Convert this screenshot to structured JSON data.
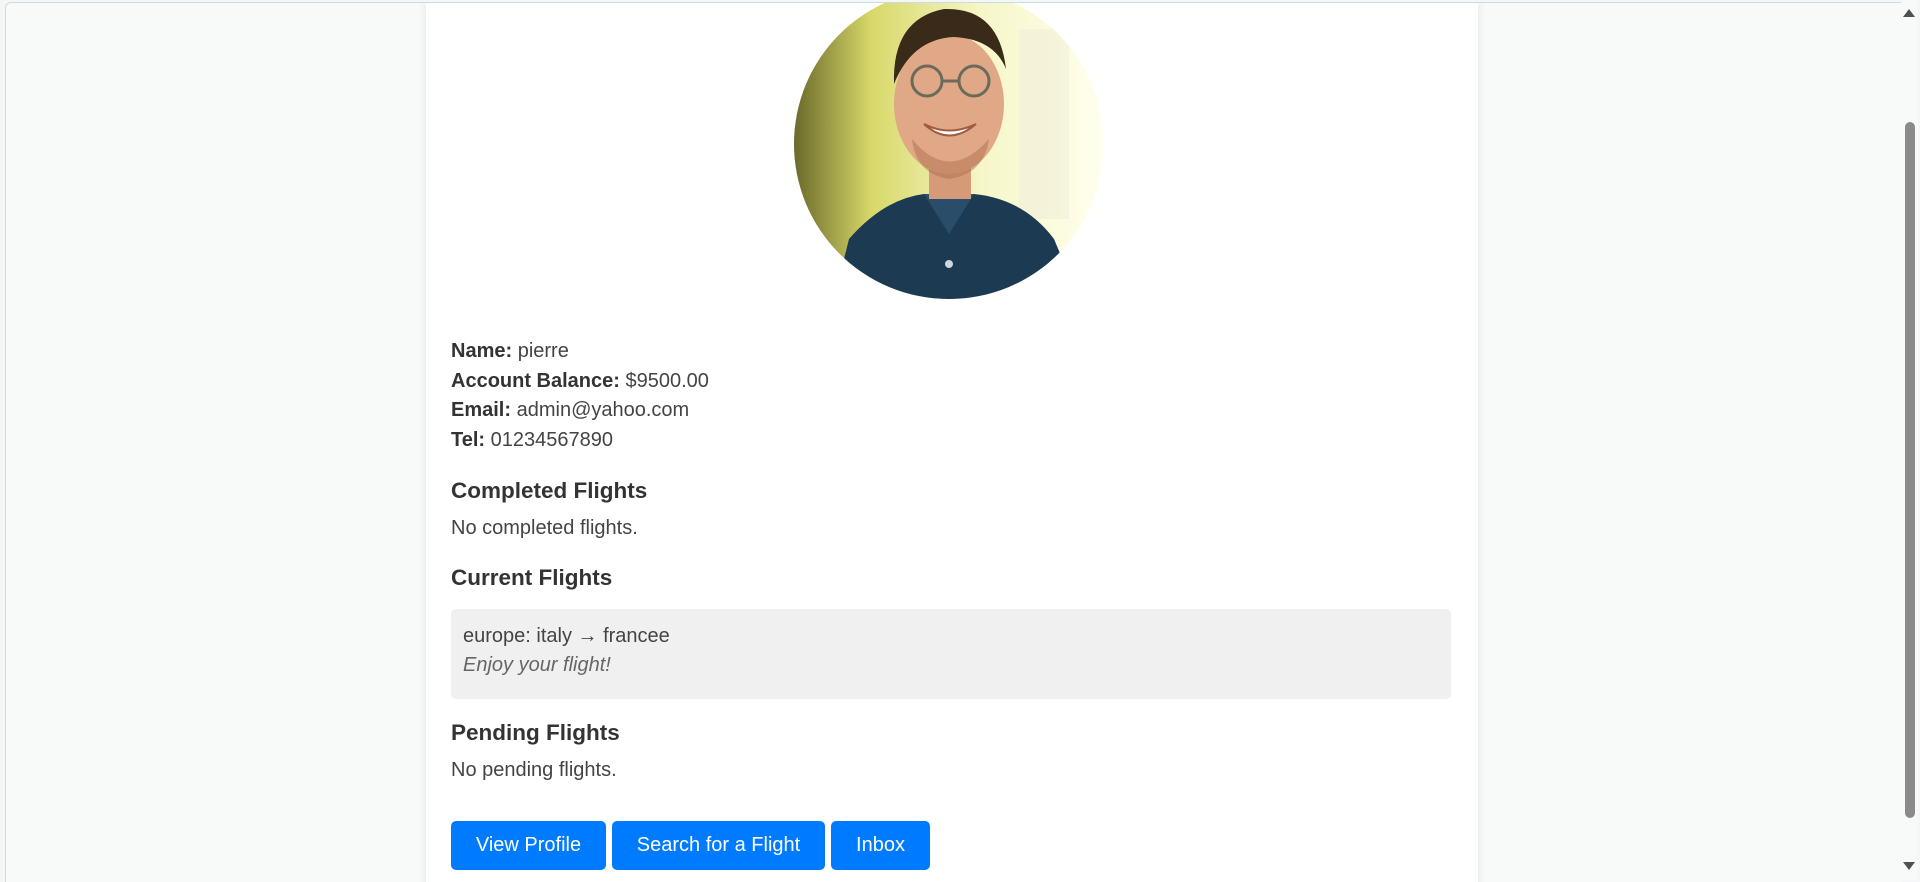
{
  "profile": {
    "name_label": "Name:",
    "name": "pierre",
    "balance_label": "Account Balance:",
    "balance": "$9500.00",
    "email_label": "Email:",
    "email": "admin@yahoo.com",
    "tel_label": "Tel:",
    "tel": "01234567890"
  },
  "completed": {
    "title": "Completed Flights",
    "empty_text": "No completed flights."
  },
  "current": {
    "title": "Current Flights",
    "flights": [
      {
        "route": "europe: italy → francee",
        "note": "Enjoy your flight!"
      }
    ]
  },
  "pending": {
    "title": "Pending Flights",
    "empty_text": "No pending flights."
  },
  "actions": {
    "view_profile": "View Profile",
    "search_flight": "Search for a Flight",
    "inbox": "Inbox"
  },
  "colors": {
    "primary_button": "#007bff",
    "flight_box_bg": "#f0f0f0"
  }
}
